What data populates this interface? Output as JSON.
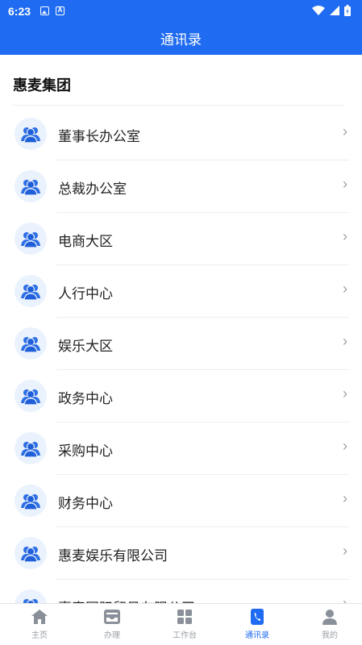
{
  "status_bar": {
    "time": "6:23"
  },
  "header": {
    "title": "通讯录"
  },
  "group": {
    "name": "惠麦集团"
  },
  "contacts": [
    {
      "label": "董事长办公室",
      "icon": "group-icon"
    },
    {
      "label": "总裁办公室",
      "icon": "group-icon"
    },
    {
      "label": "电商大区",
      "icon": "group-icon"
    },
    {
      "label": "人行中心",
      "icon": "group-icon"
    },
    {
      "label": "娱乐大区",
      "icon": "group-icon"
    },
    {
      "label": "政务中心",
      "icon": "group-icon"
    },
    {
      "label": "采购中心",
      "icon": "group-icon"
    },
    {
      "label": "财务中心",
      "icon": "group-icon"
    },
    {
      "label": "惠麦娱乐有限公司",
      "icon": "group-icon"
    },
    {
      "label": "惠麦国际贸易有限公司",
      "icon": "group-icon"
    }
  ],
  "bottom_nav": {
    "tabs": [
      {
        "label": "主页",
        "icon": "home-icon"
      },
      {
        "label": "办理",
        "icon": "inbox-icon"
      },
      {
        "label": "工作台",
        "icon": "grid-icon"
      },
      {
        "label": "通讯录",
        "icon": "phone-book-icon",
        "active": true
      },
      {
        "label": "我的",
        "icon": "person-icon"
      }
    ]
  },
  "colors": {
    "primary": "#1f6bf1",
    "avatar_bg": "#eaf2fd",
    "inactive": "#9aa0a6"
  }
}
